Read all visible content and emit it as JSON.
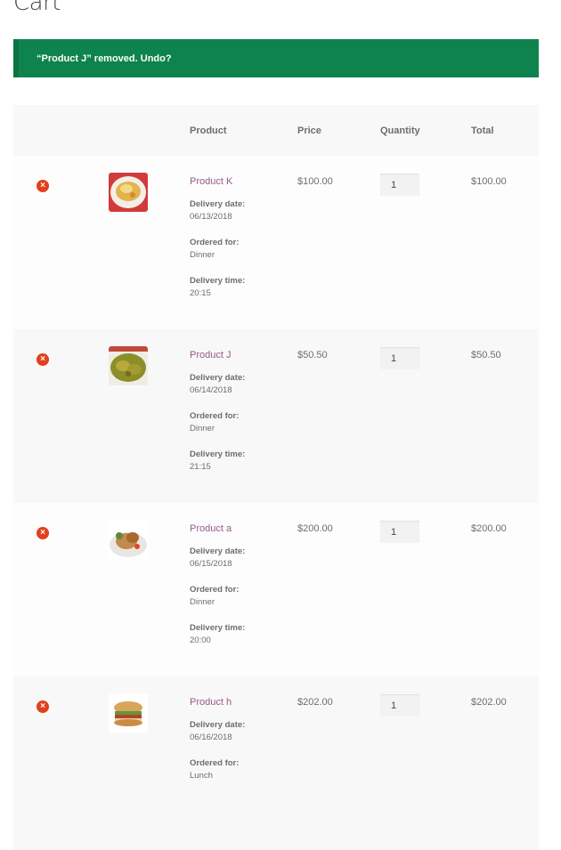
{
  "page": {
    "title": "Cart"
  },
  "notice": {
    "text": "“Product J” removed. Undo?"
  },
  "table": {
    "headers": {
      "product": "Product",
      "price": "Price",
      "quantity": "Quantity",
      "total": "Total"
    },
    "rows": [
      {
        "name": "Product K",
        "price": "$100.00",
        "quantity": "1",
        "total": "$100.00",
        "meta": [
          {
            "label": "Delivery date:",
            "value": "06/13/2018"
          },
          {
            "label": "Ordered for:",
            "value": "Dinner"
          },
          {
            "label": "Delivery time:",
            "value": "20:15"
          }
        ]
      },
      {
        "name": "Product J",
        "price": "$50.50",
        "quantity": "1",
        "total": "$50.50",
        "meta": [
          {
            "label": "Delivery date:",
            "value": "06/14/2018"
          },
          {
            "label": "Ordered for:",
            "value": "Dinner"
          },
          {
            "label": "Delivery time:",
            "value": "21:15"
          }
        ]
      },
      {
        "name": "Product a",
        "price": "$200.00",
        "quantity": "1",
        "total": "$200.00",
        "meta": [
          {
            "label": "Delivery date:",
            "value": "06/15/2018"
          },
          {
            "label": "Ordered for:",
            "value": "Dinner"
          },
          {
            "label": "Delivery time:",
            "value": "20:00"
          }
        ]
      },
      {
        "name": "Product h",
        "price": "$202.00",
        "quantity": "1",
        "total": "$202.00",
        "meta": [
          {
            "label": "Delivery date:",
            "value": "06/16/2018"
          },
          {
            "label": "Ordered for:",
            "value": "Lunch"
          }
        ]
      }
    ]
  },
  "icons": {
    "remove": "remove-circle-icon",
    "remove_glyph": "×"
  },
  "colors": {
    "notice_bg": "#0f834d",
    "remove": "#e2401c",
    "link": "#96588a"
  }
}
